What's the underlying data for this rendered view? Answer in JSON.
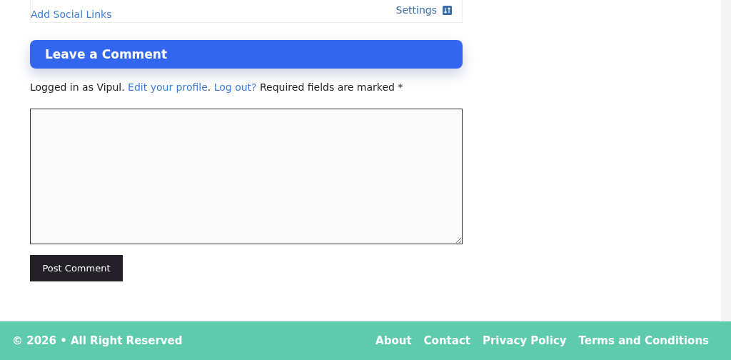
{
  "profile_card": {
    "social_link": "Add Social Links",
    "settings_link": "Settings"
  },
  "comment_heading": "Leave a Comment",
  "notice": {
    "before": "Logged in as Vipul. ",
    "profile_link": "Edit your profile",
    "between": ". ",
    "logout_link": "Log out?",
    "after": " Required fields are marked *"
  },
  "submit_button": "Post Comment",
  "footer": {
    "copyright": "© 2026 • All Right Reserved",
    "links": [
      "About",
      "Contact",
      "Privacy Policy",
      "Terms and Conditions"
    ]
  }
}
